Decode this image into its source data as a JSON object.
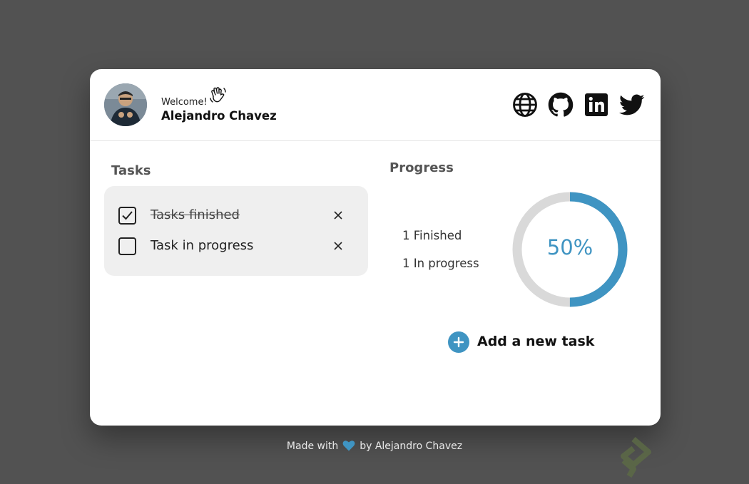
{
  "header": {
    "welcome_text": "Welcome!",
    "user_name": "Alejandro Chavez"
  },
  "social_icons": [
    "globe-icon",
    "github-icon",
    "linkedin-icon",
    "twitter-icon"
  ],
  "tasks": {
    "title": "Tasks",
    "items": [
      {
        "label": "Tasks finished",
        "completed": true
      },
      {
        "label": "Task in progress",
        "completed": false
      }
    ]
  },
  "progress": {
    "title": "Progress",
    "finished_text": "1 Finished",
    "in_progress_text": "1 In progress",
    "percent_text": "50%",
    "percent": 50
  },
  "add_task": {
    "label": "Add a new task"
  },
  "footer": {
    "made_with": "Made with",
    "by": "by Alejandro Chavez"
  },
  "colors": {
    "accent": "#3f94c2",
    "ring_track": "#d9d9d9",
    "background": "#525252",
    "card": "#ffffff",
    "task_bg": "#efefef"
  }
}
